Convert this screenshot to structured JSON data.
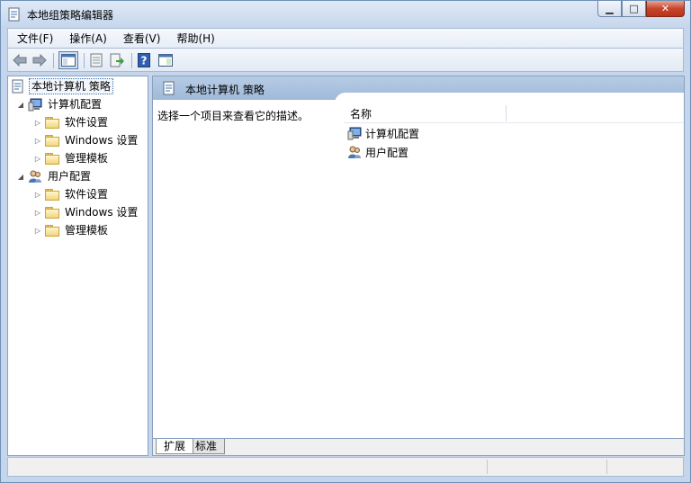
{
  "window": {
    "title": "本地组策略编辑器"
  },
  "menu": [
    "文件(F)",
    "操作(A)",
    "查看(V)",
    "帮助(H)"
  ],
  "tree": {
    "root": "本地计算机 策略",
    "computer": {
      "label": "计算机配置",
      "children": [
        "软件设置",
        "Windows 设置",
        "管理模板"
      ]
    },
    "user": {
      "label": "用户配置",
      "children": [
        "软件设置",
        "Windows 设置",
        "管理模板"
      ]
    }
  },
  "right": {
    "header": "本地计算机 策略",
    "description": "选择一个项目来查看它的描述。",
    "column_name": "名称",
    "items": [
      "计算机配置",
      "用户配置"
    ]
  },
  "tabs": [
    "扩展",
    "标准"
  ],
  "icons": {
    "app": "policy-document-icon",
    "back": "back-arrow-icon",
    "forward": "forward-arrow-icon",
    "console_tree": "show-hide-console-tree-icon",
    "properties": "properties-icon",
    "export": "export-list-icon",
    "help": "help-icon",
    "action_pane": "show-action-pane-icon",
    "computer": "computer-icon",
    "users": "users-icon",
    "folder": "folder-icon"
  }
}
